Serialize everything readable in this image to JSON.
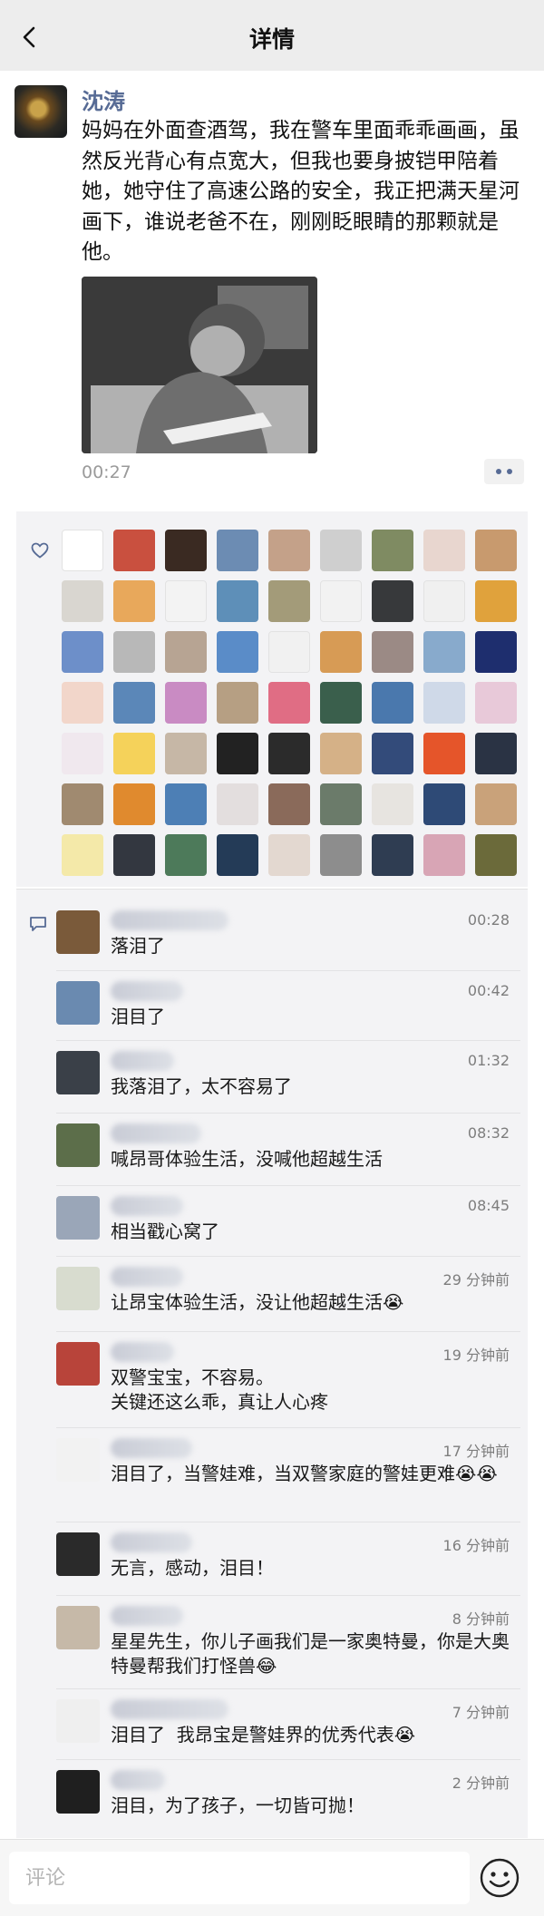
{
  "header": {
    "title": "详情"
  },
  "post": {
    "author": "沈涛",
    "text": "妈妈在外面查酒驾，我在警车里面乖乖画画，虽然反光背心有点宽大，但我也要身披铠甲陪着她，她守住了高速公路的安全，我正把满天星河画下，谁说老爸不在，刚刚眨眼睛的那颗就是他。",
    "time": "00:27"
  },
  "likes": {
    "avatar_colors": [
      "#ffffff",
      "#c9503f",
      "#3a2a22",
      "#6c8cb3",
      "#c4a189",
      "#cfcfcf",
      "#7f8b62",
      "#e8d6cf",
      "#c89a6e",
      "#d9d6d0",
      "#e8a85b",
      "#f3f3f3",
      "#5e8fb8",
      "#a39b79",
      "#f2f2f2",
      "#37393b",
      "#f0f0f0",
      "#e0a23c",
      "#6d8fc9",
      "#b8b8b8",
      "#b7a493",
      "#5a8cc8",
      "#f1f1f1",
      "#d79b55",
      "#9b8a85",
      "#88aacc",
      "#1e2e6e",
      "#f2d6ca",
      "#5b87b8",
      "#c98bc3",
      "#b69f83",
      "#e06d84",
      "#3a5f4c",
      "#4a78ad",
      "#cfd9e8",
      "#e8c9d9",
      "#f0e8ee",
      "#f5d25a",
      "#c6b7a6",
      "#222222",
      "#2b2b2b",
      "#d5b187",
      "#334b7a",
      "#e5552a",
      "#2a3344",
      "#a08a70",
      "#e08a2e",
      "#4d7fb5",
      "#e3dede",
      "#8a6a5a",
      "#6b7b6a",
      "#e7e4e0",
      "#2e4a76",
      "#c9a27a",
      "#f4e9a9",
      "#333740",
      "#4d7a5a",
      "#243b57",
      "#e3d8d0",
      "#8d8d8d",
      "#2f3d52",
      "#d8a5b5",
      "#6b6a3a"
    ]
  },
  "comments": [
    {
      "time": "00:28",
      "text": "落泪了",
      "avatar_color": "#7a5a3a"
    },
    {
      "time": "00:42",
      "text": "泪目了",
      "avatar_color": "#6a8ab0"
    },
    {
      "time": "01:32",
      "text": "我落泪了，太不容易了",
      "avatar_color": "#3a4048"
    },
    {
      "time": "08:32",
      "text": "喊昂哥体验生活，没喊他超越生活",
      "avatar_color": "#5c6e4a"
    },
    {
      "time": "08:45",
      "text": "相当戳心窝了",
      "avatar_color": "#9aa6b8"
    },
    {
      "time": "29 分钟前",
      "text": "让昂宝体验生活，没让他超越生活😭",
      "avatar_color": "#d8dccf"
    },
    {
      "time": "19 分钟前",
      "text": "双警宝宝，不容易。\n关键还这么乖，真让人心疼",
      "avatar_color": "#b8443a"
    },
    {
      "time": "17 分钟前",
      "text": "泪目了，当警娃难，当双警家庭的警娃更难😭😭",
      "avatar_color": "#f2f2f2"
    },
    {
      "time": "16 分钟前",
      "text": "无言，感动，泪目！",
      "avatar_color": "#2a2a2a"
    },
    {
      "time": "8 分钟前",
      "text": "星星先生，你儿子画我们是一家奥特曼，你是大奥特曼帮我们打怪兽😂",
      "avatar_color": "#c6b9a8"
    },
    {
      "time": "7 分钟前",
      "text": "泪目了  我昂宝是警娃界的优秀代表😭",
      "avatar_color": "#efefef"
    },
    {
      "time": "2 分钟前",
      "text": "泪目，为了孩子，一切皆可抛！",
      "avatar_color": "#1f1f1f"
    }
  ],
  "input": {
    "placeholder": "评论"
  },
  "icons": {
    "back": "chevron-left-icon",
    "more": "more-dots-icon",
    "like": "heart-icon",
    "comment": "comment-bubble-icon",
    "emoji": "smiley-icon"
  },
  "colors": {
    "author": "#576b95",
    "header_bg": "#ededed",
    "panel_bg": "#f3f3f5"
  }
}
